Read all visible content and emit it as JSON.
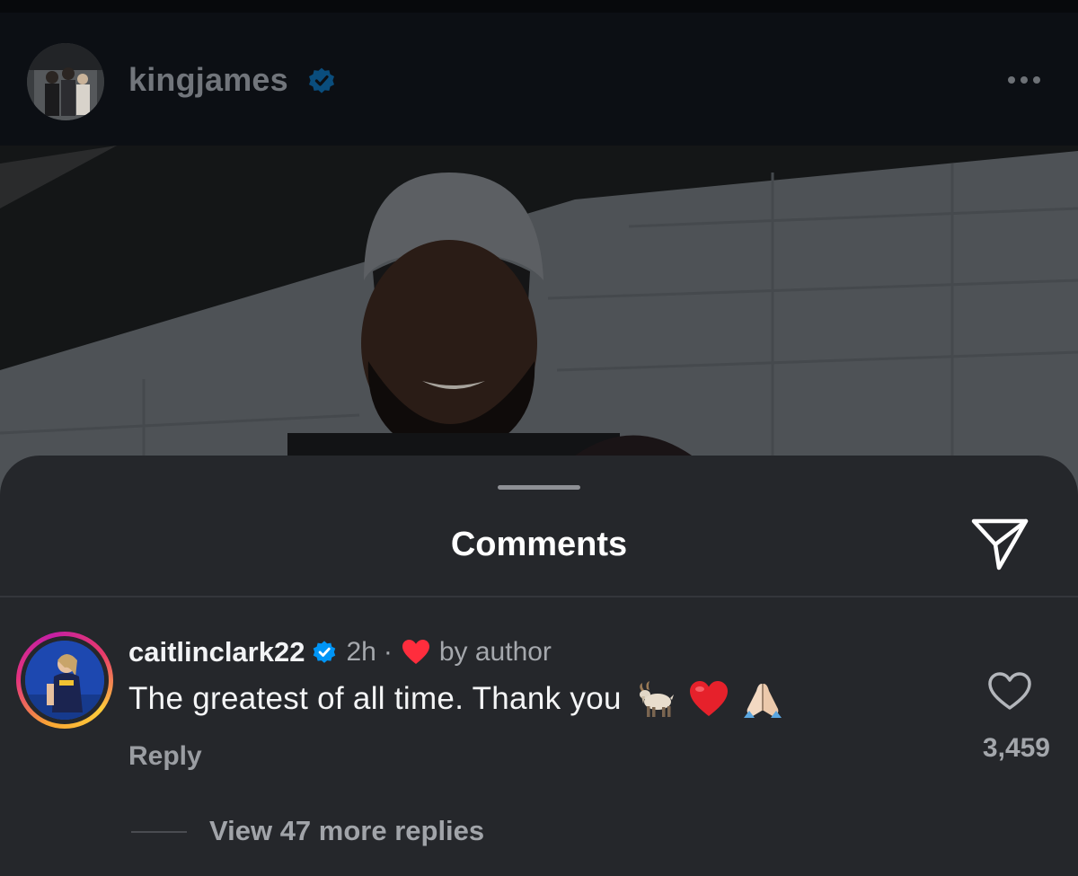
{
  "post": {
    "username": "kingjames",
    "verified": true,
    "more_icon": "more-horizontal-icon"
  },
  "comments_sheet": {
    "title": "Comments",
    "share_icon": "paper-plane-icon"
  },
  "comment": {
    "username": "caitlinclark22",
    "verified": true,
    "time": "2h",
    "separator": "·",
    "liked_by_author_label": "by author",
    "text": "The greatest of all time. Thank you",
    "emojis": [
      "goat-emoji",
      "red-heart-emoji",
      "folded-hands-emoji"
    ],
    "reply_label": "Reply",
    "like_count": "3,459",
    "view_replies_label": "View 47 more replies"
  },
  "colors": {
    "sheet_background": "#25272b",
    "verified_blue": "#0095f6",
    "heart_red": "#ff2d3d"
  }
}
